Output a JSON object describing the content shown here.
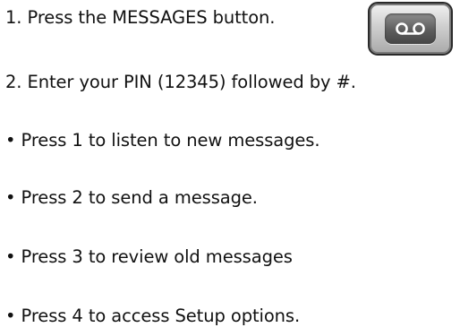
{
  "steps": [
    "1. Press the MESSAGES button.",
    "2. Enter your PIN (12345) followed by #.",
    "• Press 1 to listen to new messages.",
    "• Press 2 to send a message.",
    "• Press 3 to review old messages",
    "• Press 4 to access Setup options."
  ],
  "icons": {
    "messages_button": "voicemail-icon"
  },
  "colors": {
    "text": "#111111",
    "button_face": "#5d5d5d",
    "button_bezel": "#cfcfcf",
    "icon_stroke": "#ffffff"
  }
}
